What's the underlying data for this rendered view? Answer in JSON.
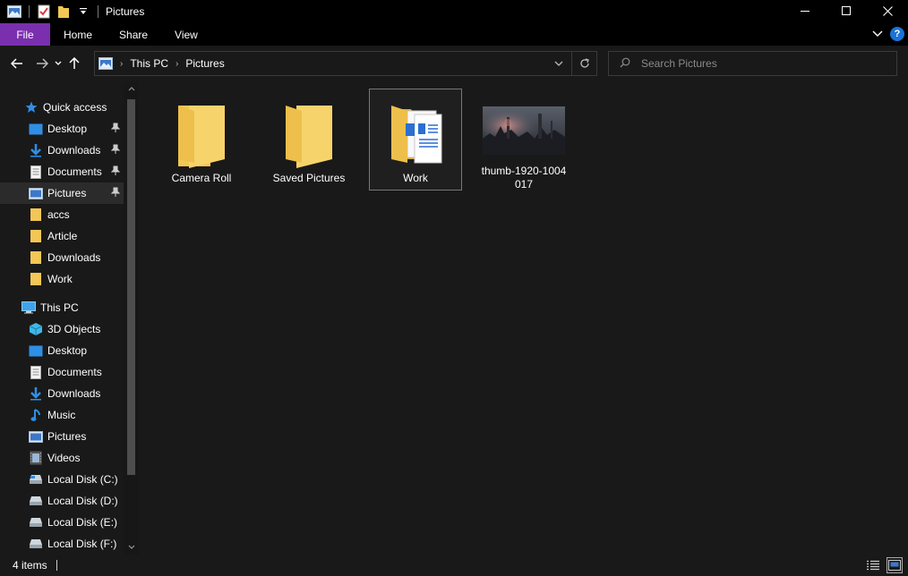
{
  "window": {
    "title": "Pictures"
  },
  "ribbon": {
    "tabs": [
      {
        "label": "File"
      },
      {
        "label": "Home"
      },
      {
        "label": "Share"
      },
      {
        "label": "View"
      }
    ]
  },
  "address": {
    "crumbs": [
      "This PC",
      "Pictures"
    ]
  },
  "search": {
    "placeholder": "Search Pictures"
  },
  "sidebar": {
    "quick_access": "Quick access",
    "quick_items": [
      {
        "label": "Desktop",
        "icon": "desktop-icon",
        "pinned": true
      },
      {
        "label": "Downloads",
        "icon": "download-icon",
        "pinned": true
      },
      {
        "label": "Documents",
        "icon": "documents-icon",
        "pinned": true
      },
      {
        "label": "Pictures",
        "icon": "pictures-icon",
        "pinned": true,
        "selected": true
      },
      {
        "label": "accs",
        "icon": "folder-icon"
      },
      {
        "label": "Article",
        "icon": "folder-icon"
      },
      {
        "label": "Downloads",
        "icon": "folder-icon"
      },
      {
        "label": "Work",
        "icon": "folder-icon"
      }
    ],
    "this_pc": "This PC",
    "pc_items": [
      {
        "label": "3D Objects",
        "icon": "3d-objects-icon"
      },
      {
        "label": "Desktop",
        "icon": "desktop-icon"
      },
      {
        "label": "Documents",
        "icon": "documents-icon"
      },
      {
        "label": "Downloads",
        "icon": "download-icon"
      },
      {
        "label": "Music",
        "icon": "music-icon"
      },
      {
        "label": "Pictures",
        "icon": "pictures-icon"
      },
      {
        "label": "Videos",
        "icon": "videos-icon"
      },
      {
        "label": "Local Disk (C:)",
        "icon": "drive-icon"
      },
      {
        "label": "Local Disk (D:)",
        "icon": "drive-icon"
      },
      {
        "label": "Local Disk (E:)",
        "icon": "drive-icon"
      },
      {
        "label": "Local Disk (F:)",
        "icon": "drive-icon"
      }
    ]
  },
  "files": [
    {
      "label": "Camera Roll",
      "type": "folder"
    },
    {
      "label": "Saved Pictures",
      "type": "folder"
    },
    {
      "label": "Work",
      "type": "folder-with-docs",
      "selected": true
    },
    {
      "label": "thumb-1920-1004017",
      "type": "image"
    }
  ],
  "status": {
    "item_count": "4 items"
  },
  "colors": {
    "file_tab": "#7a2fae",
    "background": "#191919",
    "folder": "#f3c755",
    "accent_blue": "#1a73d6"
  }
}
